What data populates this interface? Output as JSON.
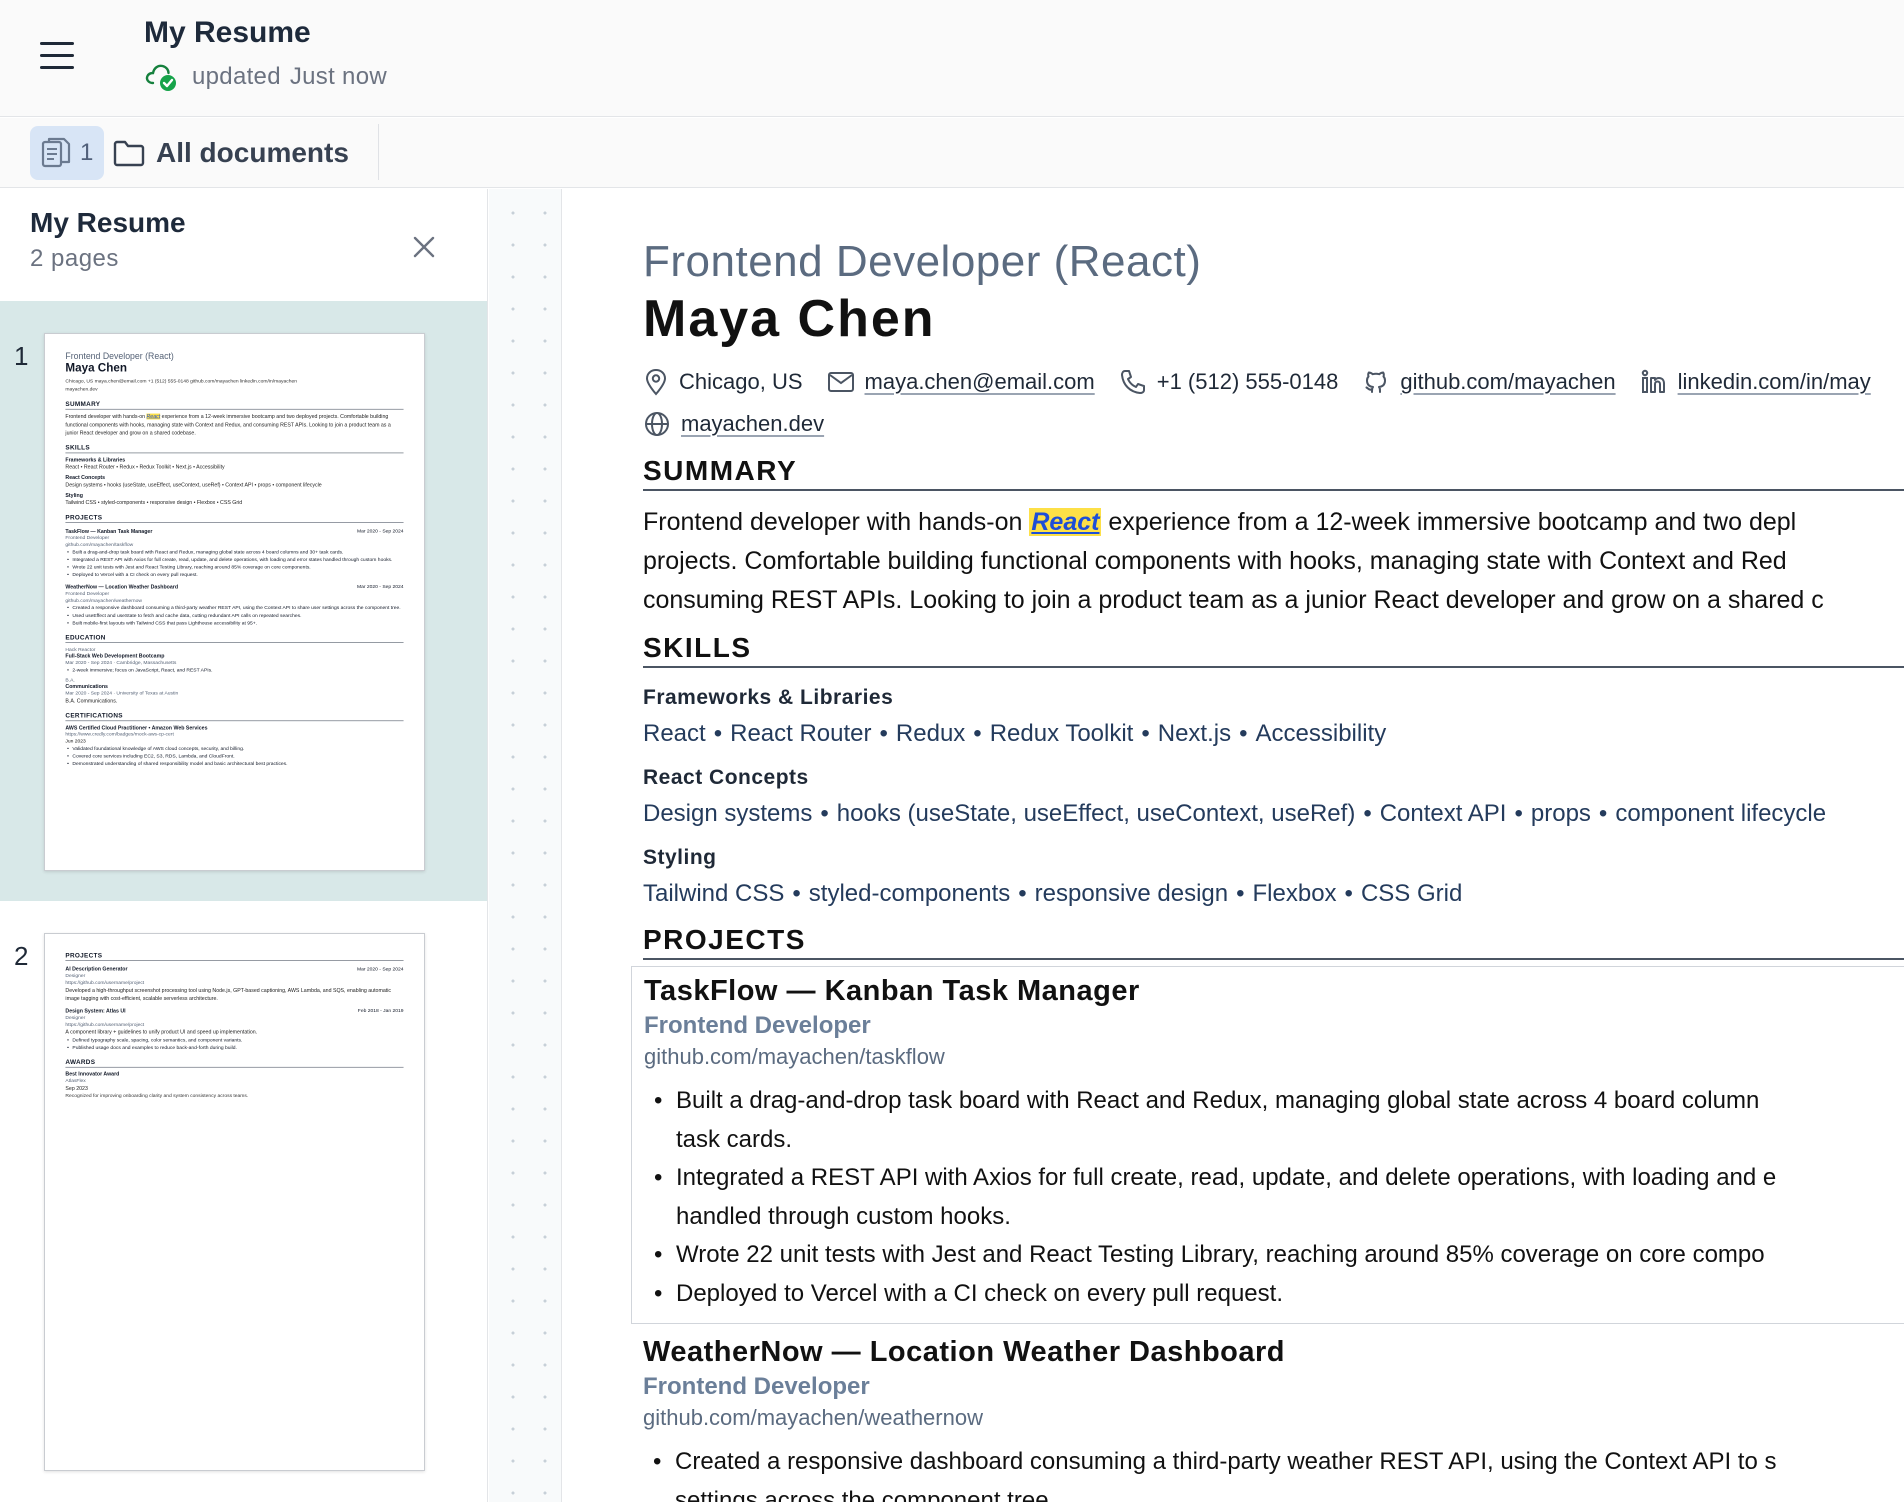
{
  "header": {
    "title": "My Resume",
    "status_word": "updated",
    "status_time": "Just now"
  },
  "toolbar": {
    "page_count": "1",
    "all_documents": "All documents"
  },
  "sidebar": {
    "title": "My Resume",
    "subtitle": "2 pages",
    "pages": [
      {
        "number": "1"
      },
      {
        "number": "2"
      }
    ]
  },
  "resume": {
    "role": "Frontend Developer (React)",
    "name": "Maya Chen",
    "contacts": {
      "location": "Chicago, US",
      "email": "maya.chen@email.com",
      "phone": "+1 (512) 555-0148",
      "github": "github.com/mayachen",
      "linkedin": "linkedin.com/in/may",
      "website": "mayachen.dev"
    },
    "summary": {
      "heading": "SUMMARY",
      "line1_pre": "Frontend developer with hands-on ",
      "highlight": "React",
      "line1_post": " experience from a 12-week immersive bootcamp and two depl",
      "line2": "projects. Comfortable building functional components with hooks, managing state with Context and Red",
      "line3": "consuming REST APIs. Looking to join a product team as a junior React developer and grow on a shared c"
    },
    "skills": {
      "heading": "SKILLS",
      "groups": [
        {
          "title": "Frameworks & Libraries",
          "items": [
            "React",
            "React Router",
            "Redux",
            "Redux Toolkit",
            "Next.js",
            "Accessibility"
          ]
        },
        {
          "title": "React Concepts",
          "items": [
            "Design systems",
            "hooks (useState, useEffect, useContext, useRef)",
            "Context API",
            "props",
            "component lifecycle"
          ]
        },
        {
          "title": "Styling",
          "items": [
            "Tailwind CSS",
            "styled-components",
            "responsive design",
            "Flexbox",
            "CSS Grid"
          ]
        }
      ]
    },
    "projects": {
      "heading": "PROJECTS",
      "items": [
        {
          "title": "TaskFlow — Kanban Task Manager",
          "date": "Mar 20",
          "role": "Frontend Developer",
          "link": "github.com/mayachen/taskflow",
          "bullets": [
            "Built a drag-and-drop task board with React and Redux, managing global state across 4 board column",
            "task cards.",
            "Integrated a REST API with Axios for full create, read, update, and delete operations, with loading and e",
            "handled through custom hooks.",
            "Wrote 22 unit tests with Jest and React Testing Library, reaching around 85% coverage on core compo",
            "Deployed to Vercel with a CI check on every pull request."
          ]
        },
        {
          "title": "WeatherNow — Location Weather Dashboard",
          "date": "Mar 20",
          "role": "Frontend Developer",
          "link": "github.com/mayachen/weathernow",
          "bullets": [
            "Created a responsive dashboard consuming a third-party weather REST API, using the Context API to s",
            "settings across the component tree."
          ]
        }
      ]
    }
  },
  "thumb1": {
    "role": "Frontend Developer (React)",
    "name": "Maya Chen",
    "contact_line1": "Chicago, US   maya.chen@email.com   +1 (512) 555-0148   github.com/mayachen   linkedin.com/in/mayachen",
    "contact_line2": "mayachen.dev",
    "summary_h": "SUMMARY",
    "summary_pre": "Frontend developer with hands-on ",
    "summary_hl": "React",
    "summary_post": " experience from a 12-week immersive bootcamp and two deployed projects. Comfortable building functional components with hooks, managing state with Context and Redux, and consuming REST APIs. Looking to join a product team as a junior React developer and grow on a shared codebase.",
    "skills_h": "SKILLS",
    "sk1_t": "Frameworks & Libraries",
    "sk1": "React • React Router • Redux • Redux Toolkit • Next.js • Accessibility",
    "sk2_t": "React Concepts",
    "sk2": "Design systems • hooks (useState, useEffect, useContext, useRef) • Context API • props • component lifecycle",
    "sk3_t": "Styling",
    "sk3": "Tailwind CSS • styled-components • responsive design • Flexbox • CSS Grid",
    "projects_h": "PROJECTS",
    "p1_t": "TaskFlow — Kanban Task Manager",
    "p1_d": "Mar 2020 - Sep 2024",
    "p1_r": "Frontend Developer",
    "p1_l": "github.com/mayachen/taskflow",
    "p1_b1": "Built a drag-and-drop task board with React and Redux, managing global state across 4 board columns and 30+ task cards.",
    "p1_b2": "Integrated a REST API with Axios for full create, read, update, and delete operations, with loading and error states handled through custom hooks.",
    "p1_b3": "Wrote 22 unit tests with Jest and React Testing Library, reaching around 85% coverage on core components.",
    "p1_b4": "Deployed to Vercel with a CI check on every pull request.",
    "p2_t": "WeatherNow — Location Weather Dashboard",
    "p2_d": "Mar 2020 - Sep 2024",
    "p2_r": "Frontend Developer",
    "p2_l": "github.com/mayachen/weathernow",
    "p2_b1": "Created a responsive dashboard consuming a third-party weather REST API, using the Context API to share user settings across the component tree.",
    "p2_b2": "Used useEffect and useState to fetch and cache data, cutting redundant API calls on repeated searches.",
    "p2_b3": "Built mobile-first layouts with Tailwind CSS that pass Lighthouse accessibility at 95+.",
    "edu_h": "EDUCATION",
    "e1_s": "Hack Reactor",
    "e1_t": "Full-Stack Web Development Bootcamp",
    "e1_d": "Mar 2020 - Sep 2024 · Cambridge, Massachusetts",
    "e1_b": "2-week immersive; focus on JavaScript, React, and REST APIs.",
    "e2_s": "B.A.",
    "e2_t": "Communications",
    "e2_d": "Mar 2020 - Sep 2024 · University of Texas at Austin",
    "e2_x": "B.A. Communications.",
    "cert_h": "CERTIFICATIONS",
    "c1_t": "AWS Certified Cloud Practitioner  •  Amazon Web Services",
    "c1_l": "https://www.credly.com/badges/mock-aws-cp-cert",
    "c1_d": "Jun 2023",
    "c1_b1": "Validated foundational knowledge of AWS cloud concepts, security, and billing.",
    "c1_b2": "Covered core services including EC2, S3, RDS, Lambda, and CloudFront.",
    "c1_b3": "Demonstrated understanding of shared responsibility model and basic architectural best practices."
  },
  "thumb2": {
    "projects_h": "PROJECTS",
    "p1_t": "AI Description Generator",
    "p1_d": "Mar 2020 - Sep 2024",
    "p1_r": "Designer",
    "p1_l": "https://github.com/username/project",
    "p1_x": "Developed a high-throughput screenshot processing tool using Node.js, GPT-based captioning, AWS Lambda, and SQS, enabling automatic image tagging with cost-efficient, scalable serverless architecture.",
    "p2_t": "Design System: Atlas UI",
    "p2_d": "Feb 2018 - Jan 2019",
    "p2_r": "Designer",
    "p2_l": "https://github.com/username/project",
    "p2_x": "A component library + guidelines to unify product UI and speed up implementation.",
    "p2_b1": "Defined typography scale, spacing, color semantics, and component variants.",
    "p2_b2": "Published usage docs and examples to reduce back-and-forth during build.",
    "awards_h": "AWARDS",
    "a1_t": "Best Innovator Award",
    "a1_s": "AtlasFlex",
    "a1_d": "Sep 2023",
    "a1_x": "Recognized for improving onboarding clarity and system consistency across teams."
  }
}
